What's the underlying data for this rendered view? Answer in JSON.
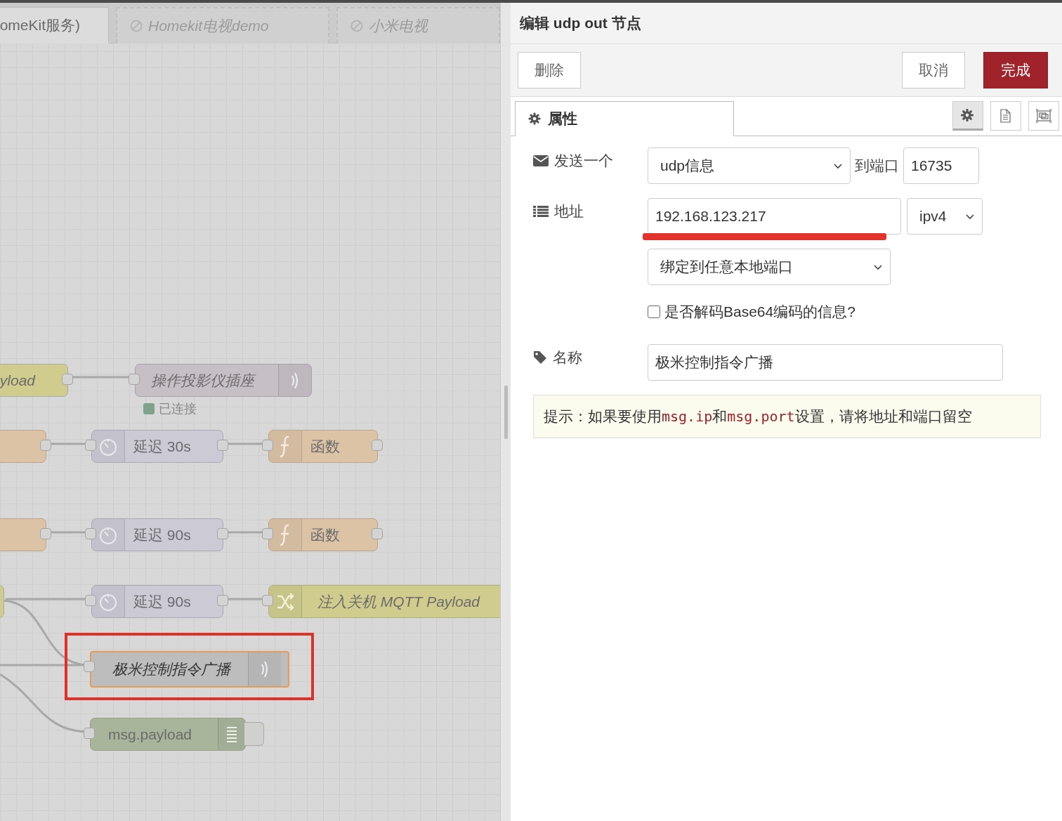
{
  "flow_tabs": [
    {
      "label": "omeKit服务)",
      "disabled": false,
      "selected": true
    },
    {
      "label": "Homekit电视demo",
      "disabled": true,
      "selected": false
    },
    {
      "label": "小米电视",
      "disabled": true,
      "selected": false
    }
  ],
  "canvas": {
    "nodes": [
      {
        "kind": "inject",
        "label": "yload",
        "italic": true
      },
      {
        "kind": "udp",
        "label": "操作投影仪插座",
        "italic": true,
        "status": {
          "text": "已连接",
          "color": "#7fa28c"
        }
      },
      {
        "kind": "function"
      },
      {
        "kind": "delay",
        "label": "延迟 30s",
        "italic": false
      },
      {
        "kind": "function",
        "label": "函数",
        "italic": false
      },
      {
        "kind": "function"
      },
      {
        "kind": "delay",
        "label": "延迟 90s",
        "italic": false
      },
      {
        "kind": "function",
        "label": "函数",
        "italic": false
      },
      {
        "kind": "inject"
      },
      {
        "kind": "delay",
        "label": "延迟 90s",
        "italic": false
      },
      {
        "kind": "change",
        "label": "注入关机 MQTT Payload",
        "italic": true
      },
      {
        "kind": "udp",
        "label": "极米控制指令广播",
        "italic": true,
        "selected": true,
        "highlighted": true
      },
      {
        "kind": "debug",
        "label": "msg.payload",
        "italic": false
      }
    ]
  },
  "editor": {
    "title": "编辑 udp out 节点",
    "buttons": [
      {
        "label": "删除",
        "kind": "delete"
      },
      {
        "label": "取消",
        "kind": "cancel"
      },
      {
        "label": "完成",
        "kind": "primary"
      }
    ],
    "tabs": [
      {
        "label": "属性",
        "selected": true
      }
    ],
    "tab_icons": [
      {
        "kind": "settings",
        "selected": true
      },
      {
        "kind": "description",
        "selected": false
      },
      {
        "kind": "appearance",
        "selected": false
      }
    ],
    "send": {
      "label": "发送一个",
      "value": "udp信息",
      "port_label": "到端口",
      "port": "16735"
    },
    "address": {
      "label": "地址",
      "value": "192.168.123.217",
      "underlined": true,
      "family": "ipv4"
    },
    "bind": {
      "value": "绑定到任意本地端口"
    },
    "decode_base64": {
      "label": "是否解码Base64编码的信息?",
      "checked": false
    },
    "name": {
      "label": "名称",
      "value": "极米控制指令广播"
    },
    "tip": [
      {
        "text": "提示：如果要使用",
        "kind": "plain"
      },
      {
        "text": "msg.ip",
        "kind": "code"
      },
      {
        "text": "和",
        "kind": "plain"
      },
      {
        "text": "msg.port",
        "kind": "code"
      },
      {
        "text": "设置，请将地址和端口留空",
        "kind": "plain"
      }
    ]
  }
}
